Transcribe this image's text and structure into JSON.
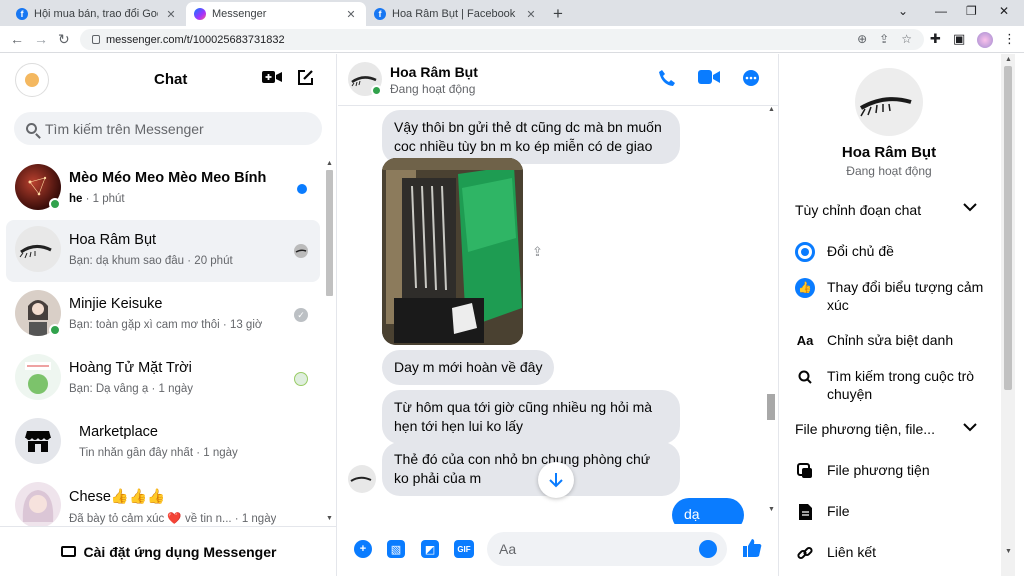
{
  "browser": {
    "tabs": [
      {
        "title": "Hội mua bán, trao đổi Goods Anim",
        "favicon": "facebook-icon"
      },
      {
        "title": "Messenger",
        "favicon": "messenger-icon"
      },
      {
        "title": "Hoa Râm Bụt | Facebook",
        "favicon": "facebook-icon"
      }
    ],
    "url": "messenger.com/t/100025683731832"
  },
  "left": {
    "title": "Chat",
    "search_placeholder": "Tìm kiếm trên Messenger",
    "conversations": [
      {
        "name": "Mèo Méo Meo Mèo Meo Bính",
        "sender": "he",
        "time": " · 1 phút",
        "unread": true
      },
      {
        "name": "Hoa Râm Bụt",
        "preview": "Bạn: dạ khum sao đâu · 20 phút"
      },
      {
        "name": "Minjie Keisuke",
        "preview": "Bạn: toàn gặp xì cam mơ thôi · 13 giờ"
      },
      {
        "name": "Hoàng Tử Mặt Trời",
        "preview": "Bạn: Dạ vâng ạ · 1 ngày"
      },
      {
        "name": "Marketplace",
        "preview": "Tin nhắn gần đây nhất · 1 ngày"
      },
      {
        "name": "Chese👍👍👍",
        "preview": "Đã bày tỏ cảm xúc ❤️ về tin n... · 1 ngày"
      }
    ],
    "footer": "Cài đặt ứng dụng Messenger"
  },
  "chat": {
    "name": "Hoa Râm Bụt",
    "status": "Đang hoạt động",
    "messages": [
      "Vậy thôi bn gửi thẻ dt cũng dc mà bn muốn coc nhiều tùy bn m ko ép miễn có de giao",
      "Day m mới hoàn về đây",
      "Từ hôm qua tới giờ cũng nhiều ng hỏi mà hẹn tới hẹn lui ko lấy",
      "Thẻ đó của con nhỏ bn chung phòng chứ ko phải của m"
    ],
    "outgoing": "dạ vâng",
    "composer_placeholder": "Aa"
  },
  "info": {
    "name": "Hoa Râm Bụt",
    "status": "Đang hoạt động",
    "section_customize": "Tùy chỉnh đoạn chat",
    "items_customize": [
      "Đổi chủ đề",
      "Thay đổi biểu tượng cảm xúc",
      "Chỉnh sửa biệt danh",
      "Tìm kiếm trong cuộc trò chuyện"
    ],
    "section_media": "File phương tiện, file...",
    "items_media": [
      "File phương tiện",
      "File",
      "Liên kết"
    ]
  },
  "colors": {
    "accent": "#0a7cff",
    "online": "#31a24c",
    "bubble": "#e4e6eb"
  }
}
